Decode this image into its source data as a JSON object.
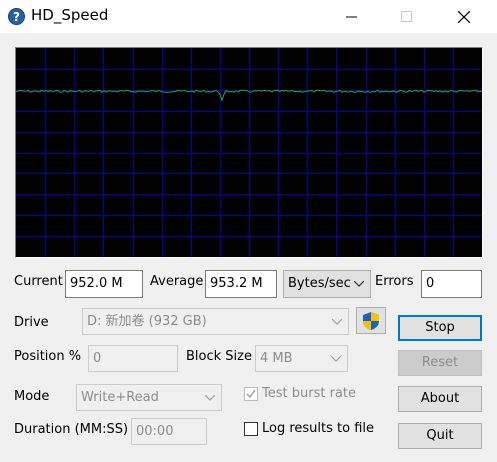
{
  "window": {
    "title": "HD_Speed",
    "icon": "question-icon"
  },
  "graph": {
    "background": "#000000",
    "grid_color": "#0000b4",
    "line_color": "#2fa53a",
    "level_fraction": 0.793
  },
  "readings": {
    "current_label": "Current",
    "current_value": "952.0 M",
    "average_label": "Average",
    "average_value": "953.2 M",
    "units_value": "Bytes/sec",
    "errors_label": "Errors",
    "errors_value": "0"
  },
  "settings": {
    "drive_label": "Drive",
    "drive_value": "D: 新加卷 (932 GB)",
    "position_label": "Position %",
    "position_value": "0",
    "block_size_label": "Block Size",
    "block_size_value": "4 MB",
    "mode_label": "Mode",
    "mode_value": "Write+Read",
    "test_burst_label": "Test burst rate",
    "test_burst_checked": true,
    "duration_label": "Duration (MM:SS)",
    "duration_value": "00:00",
    "log_label": "Log results to file",
    "log_checked": false
  },
  "buttons": {
    "stop": "Stop",
    "reset": "Reset",
    "about": "About",
    "quit": "Quit"
  },
  "colors": {
    "accent": "#0078d7",
    "shield_blue": "#1f5fbf",
    "shield_yellow": "#f2c500"
  }
}
